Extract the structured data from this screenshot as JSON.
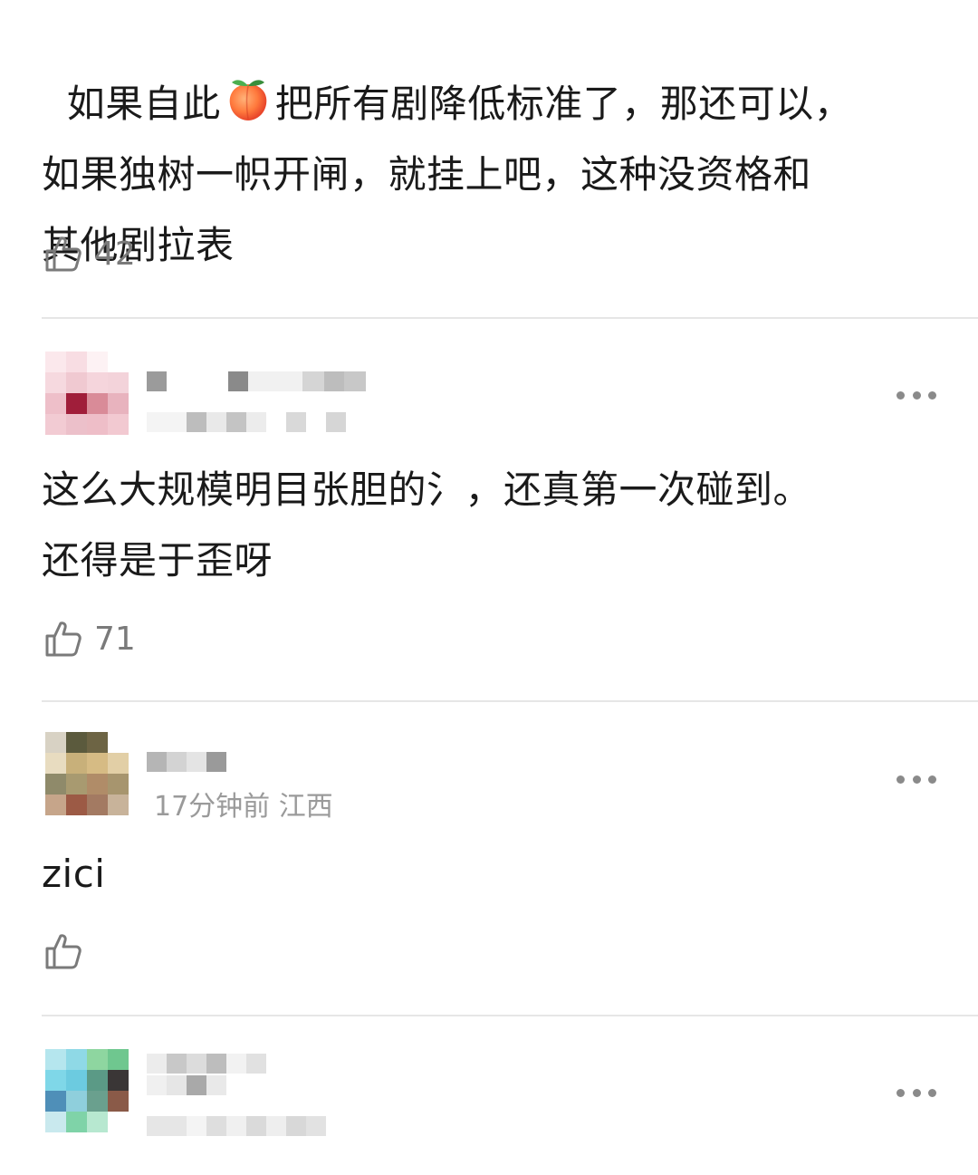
{
  "comments": [
    {
      "text_parts": [
        "如果自此",
        "把所有剧降低标准了，那还可以，",
        "如果独树一帜开闸，就挂上吧，这种没资格和",
        "其他剧拉表"
      ],
      "emoji": "peach",
      "likes": "42"
    },
    {
      "username": "",
      "meta": "",
      "text_lines": [
        "这么大规模明目张胆的氵，还真第一次碰到。",
        "还得是于歪呀"
      ],
      "likes": "71"
    },
    {
      "username": "",
      "meta": "17分钟前 江西",
      "text_lines": [
        "zici"
      ],
      "likes": ""
    },
    {
      "username": "",
      "meta": "",
      "text_lines": [],
      "likes": ""
    }
  ],
  "icons": {
    "like": "thumbs-up-icon",
    "more": "more-dots-icon",
    "emoji": "peach-emoji-icon"
  },
  "colors": {
    "text": "#1a1a1a",
    "secondary": "#9a9a9a",
    "divider": "#e6e6e6",
    "icon": "#7a7a7a"
  }
}
